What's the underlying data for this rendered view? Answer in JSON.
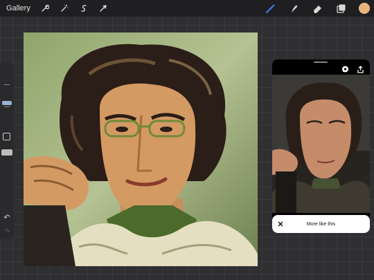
{
  "topbar": {
    "gallery_label": "Gallery",
    "left_tools": [
      {
        "icon": "wrench-icon"
      },
      {
        "icon": "magic-wand-icon"
      },
      {
        "icon": "selection-icon"
      },
      {
        "icon": "transform-arrow-icon"
      }
    ],
    "right_tools": [
      {
        "icon": "brush-icon",
        "active": true
      },
      {
        "icon": "smudge-icon"
      },
      {
        "icon": "eraser-icon"
      },
      {
        "icon": "layers-icon"
      }
    ],
    "current_color": "#e8b27a",
    "accent_color": "#3d7cf2"
  },
  "sidebar": {
    "undo_icon": "↶",
    "redo_icon": "↷"
  },
  "reference_panel": {
    "more_like_this_label": "More like this",
    "close_icon": "✕"
  }
}
